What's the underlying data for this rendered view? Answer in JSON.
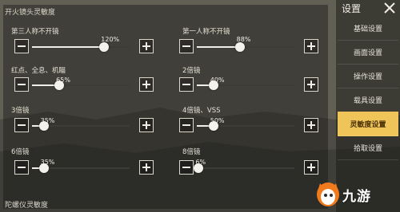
{
  "sections": {
    "scope_title": "开火镜头灵敏度",
    "gyro_title": "陀螺仪灵敏度"
  },
  "sliders": [
    {
      "label": "第三人称不开镜",
      "value": "120%",
      "level": 0.74
    },
    {
      "label": "第一人称不开镜",
      "value": "88%",
      "level": 0.44
    },
    {
      "label": "红点、全息、机瞄",
      "value": "65%",
      "level": 0.28
    },
    {
      "label": "2倍镜",
      "value": "40%",
      "level": 0.17
    },
    {
      "label": "3倍镜",
      "value": "35%",
      "level": 0.12
    },
    {
      "label": "4倍镜、VSS",
      "value": "50%",
      "level": 0.17
    },
    {
      "label": "6倍镜",
      "value": "35%",
      "level": 0.12
    },
    {
      "label": "8倍镜",
      "value": "6%",
      "level": 0.02
    }
  ],
  "sidebar": {
    "title": "设置",
    "items": [
      {
        "label": "基础设置"
      },
      {
        "label": "画面设置"
      },
      {
        "label": "操作设置"
      },
      {
        "label": "载具设置"
      },
      {
        "label": "灵敏度设置"
      },
      {
        "label": "拾取设置"
      }
    ],
    "active_index": 4
  },
  "watermark": {
    "text": "九游",
    "accent": "#f07a1c"
  },
  "colors": {
    "active_tab": "#efc55a",
    "track": "#3c3b37",
    "fill": "#f2efe6"
  },
  "icons": {
    "minus": "minus-icon",
    "plus": "plus-icon",
    "close": "close-icon"
  }
}
